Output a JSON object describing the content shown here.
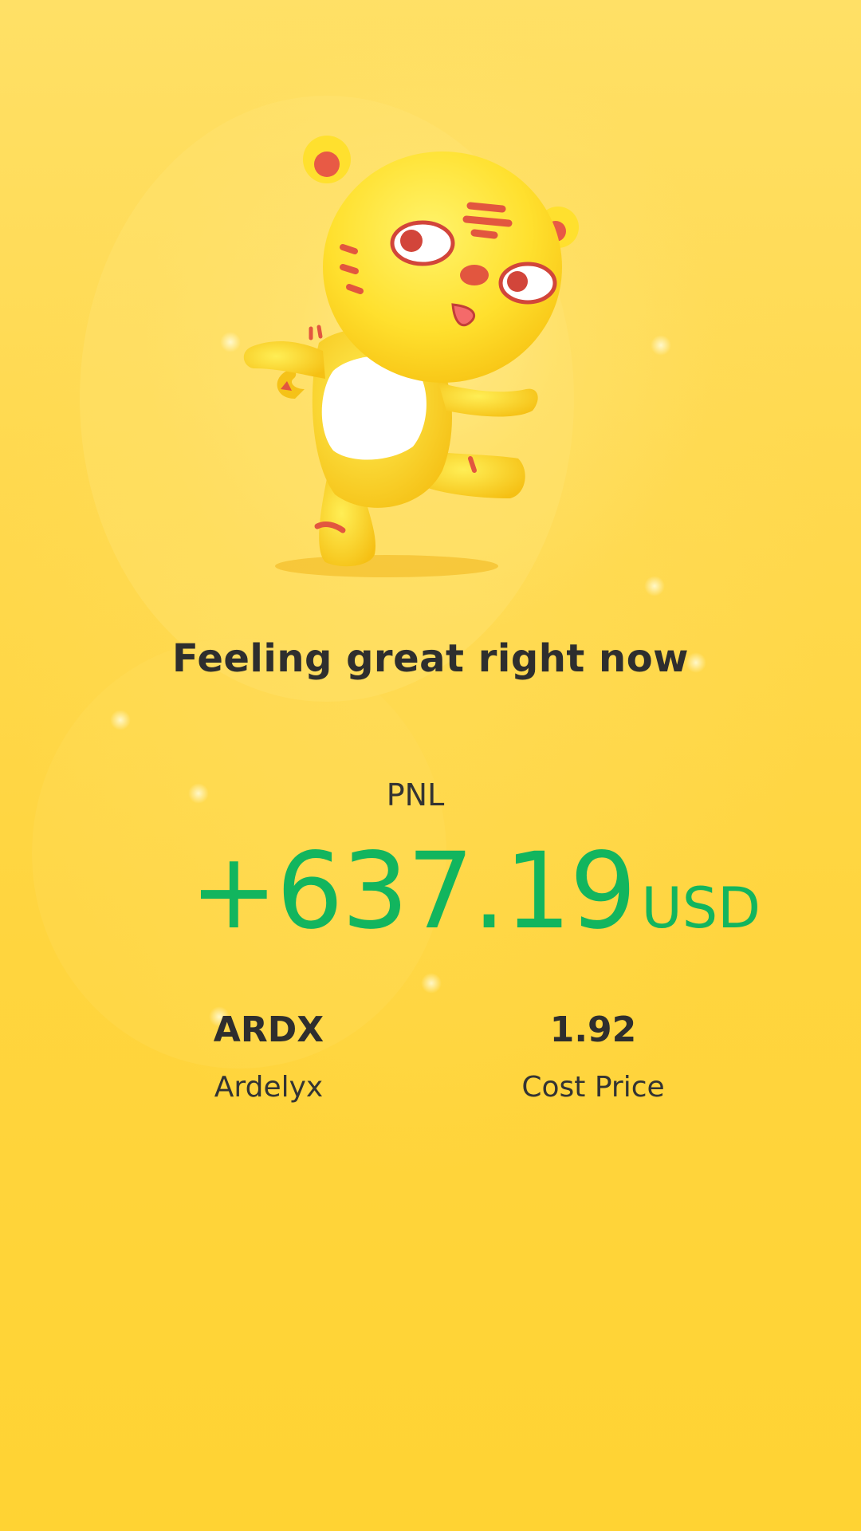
{
  "headline": "Feeling great right now",
  "pnl": {
    "label": "PNL",
    "value": "+637.19",
    "currency": "USD"
  },
  "stock": {
    "ticker": "ARDX",
    "name": "Ardelyx"
  },
  "cost": {
    "value": "1.92",
    "label": "Cost Price"
  },
  "colors": {
    "background": "#FFD43A",
    "profit": "#12B55E",
    "text": "#2E2E2E"
  },
  "icons": {
    "mascot": "tiger-mascot-icon"
  }
}
